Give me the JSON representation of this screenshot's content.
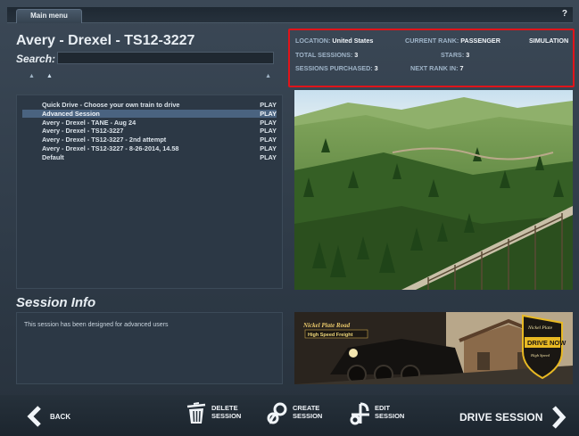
{
  "topbar": {
    "tab_label": "Main menu",
    "help_label": "?"
  },
  "route": {
    "title": "Avery - Drexel - TS12-3227",
    "search_label": "Search:",
    "search_value": "",
    "search_placeholder": ""
  },
  "sessions": [
    {
      "name": "Quick Drive - Choose your own train to drive",
      "action": "PLAY",
      "selected": false
    },
    {
      "name": "Advanced Session",
      "action": "PLAY",
      "selected": true
    },
    {
      "name": "Avery - Drexel - TANE - Aug 24",
      "action": "PLAY",
      "selected": false
    },
    {
      "name": "Avery - Drexel - TS12-3227",
      "action": "PLAY",
      "selected": false
    },
    {
      "name": "Avery - Drexel - TS12-3227 - 2nd attempt",
      "action": "PLAY",
      "selected": false
    },
    {
      "name": "Avery - Drexel - TS12-3227 - 8-26-2014, 14.58",
      "action": "PLAY",
      "selected": false
    },
    {
      "name": "Default",
      "action": "PLAY",
      "selected": false
    }
  ],
  "session_info": {
    "title": "Session Info",
    "description": "This session has been designed for advanced users"
  },
  "stats": {
    "location_label": "LOCATION:",
    "location_value": "United States",
    "rank_label": "CURRENT RANK:",
    "rank_value": "PASSENGER",
    "mode_value": "SIMULATION",
    "total_sessions_label": "TOTAL SESSIONS:",
    "total_sessions_value": "3",
    "stars_label": "STARS:",
    "stars_value": "3",
    "purchased_label": "SESSIONS PURCHASED:",
    "purchased_value": "3",
    "next_rank_label": "NEXT RANK IN:",
    "next_rank_value": "7"
  },
  "banner": {
    "logo_line1": "Nickel Plate Road",
    "logo_line2": "High Speed Freight",
    "badge_top": "Nickel Plate",
    "badge_main": "DRIVE NOW",
    "badge_sub": "High Speed"
  },
  "bottombar": {
    "back_label": "BACK",
    "delete_line1": "DELETE",
    "delete_line2": "SESSION",
    "create_line1": "CREATE",
    "create_line2": "SESSION",
    "edit_line1": "EDIT",
    "edit_line2": "SESSION",
    "drive_label": "DRIVE SESSION"
  },
  "colors": {
    "highlight_border": "#e0141a",
    "selected_row": "#4a6380",
    "badge_gold": "#e8b923"
  },
  "icons": {
    "back": "chevron-left-icon",
    "delete": "trash-icon",
    "create": "link-create-icon",
    "edit": "link-edit-icon",
    "drive": "chevron-right-icon"
  }
}
